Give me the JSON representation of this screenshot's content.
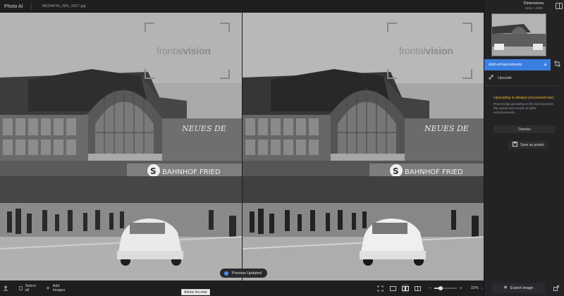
{
  "app": {
    "title": "Photo AI",
    "file_name": "MEDIAFIN_IMG_0537.jpg"
  },
  "watermark": {
    "light": "frontal",
    "bold": "vision"
  },
  "photo_sign": {
    "main": "BAHNHOF FRIED",
    "top": "NEUES DE",
    "station_letter": "S"
  },
  "preview": {
    "status": "Preview Updated"
  },
  "bottombar": {
    "select_all": "Select all",
    "add_images": "Add images",
    "zoom_level": "33%",
    "zoom_fraction": 0.3,
    "tooltip": "Adobe Acrobat"
  },
  "panel": {
    "dimensions_title": "Dimensions",
    "dimensions_value": "4245 × 2830",
    "add_enhancements": "Add enhancements",
    "upscale": "Upscale",
    "warning_title": "Upscaling is always processed last.",
    "warning_body": "Processing upscaling at the end improves the speed and results of other enhancements.",
    "dismiss": "Dismiss",
    "save_preset": "Save as preset",
    "export": "Export image"
  },
  "colors": {
    "accent": "#3a7ee0",
    "warning": "#e8b320",
    "panel_bg": "#232326"
  }
}
